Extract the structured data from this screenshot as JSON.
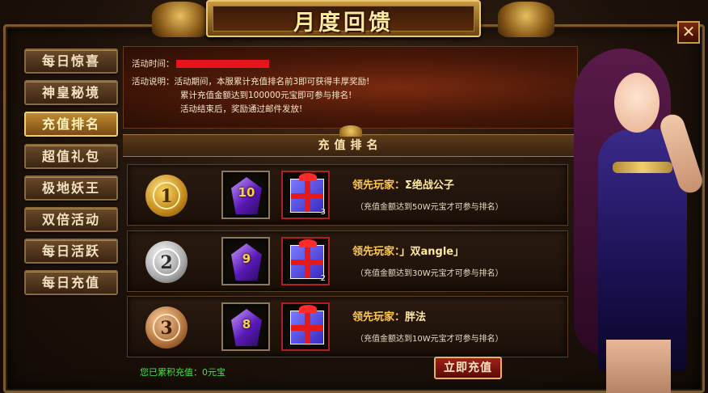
{
  "window": {
    "title": "月度回馈",
    "close_glyph": "✕"
  },
  "sidebar": {
    "items": [
      {
        "label": "每日惊喜",
        "active": false
      },
      {
        "label": "神皇秘境",
        "active": false
      },
      {
        "label": "充值排名",
        "active": true
      },
      {
        "label": "超值礼包",
        "active": false
      },
      {
        "label": "极地妖王",
        "active": false
      },
      {
        "label": "双倍活动",
        "active": false
      },
      {
        "label": "每日活跃",
        "active": false
      },
      {
        "label": "每日充值",
        "active": false
      }
    ]
  },
  "info": {
    "time_label": "活动时间：",
    "desc_label": "活动说明：",
    "desc_line1": "活动期间，本服累计充值排名前3即可获得丰厚奖励!",
    "desc_line2": "累计充值金额达到100000元宝即可参与排名!",
    "desc_line3": "活动结束后，奖励通过邮件发放!"
  },
  "section": {
    "title": "充值排名"
  },
  "ranks": [
    {
      "rank": "1",
      "medal": "gold-medal-icon",
      "gem_number": "10",
      "gift_qty": "3",
      "leader_label": "领先玩家：",
      "leader_name": "Σ绝战公子",
      "condition": "（充值金额达到50W元宝才可参与排名）"
    },
    {
      "rank": "2",
      "medal": "silver-medal-icon",
      "gem_number": "9",
      "gift_qty": "2",
      "leader_label": "领先玩家：",
      "leader_name": "」双angle」",
      "condition": "（充值金额达到30W元宝才可参与排名）"
    },
    {
      "rank": "3",
      "medal": "bronze-medal-icon",
      "gem_number": "8",
      "gift_qty": "",
      "leader_label": "领先玩家：",
      "leader_name": "胖法",
      "condition": "（充值金额达到10W元宝才可参与排名）"
    }
  ],
  "footer": {
    "total_label": "您已累积充值：",
    "total_value": "0元宝",
    "recharge_button": "立即充值"
  },
  "colors": {
    "accent_gold": "#ffc94a",
    "total_green": "#4ae04a",
    "redacted_bar": "#e8141c"
  }
}
